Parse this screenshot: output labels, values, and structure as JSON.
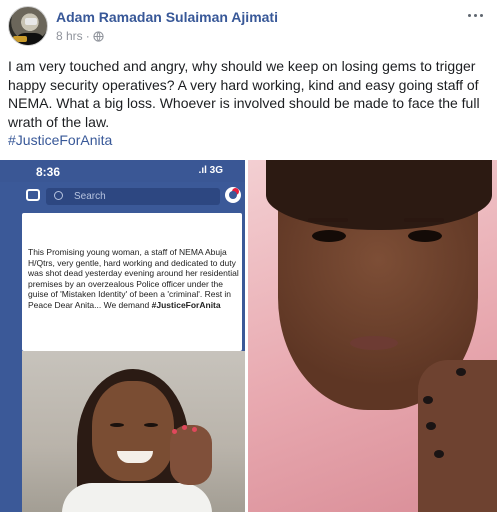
{
  "post": {
    "author": "Adam Ramadan Sulaiman Ajimati",
    "timestamp": "8 hrs",
    "separator": "·",
    "privacy_icon": "globe-icon",
    "more_icon": "ellipsis-icon",
    "body": "I am very touched and angry, why should we keep on losing gems to trigger happy security operatives? A very hard working, kind and easy going staff of NEMA. What a big loss. Whoever is involved should be made to face the full wrath of the law.",
    "hashtag": "#JusticeForAnita"
  },
  "colors": {
    "link": "#385898",
    "meta": "#90949c",
    "facebook_blue": "#3b5998"
  },
  "phone_screenshot": {
    "time": "8:36",
    "signal": ".ıl 3G",
    "search_placeholder": "Search",
    "caption": "This Promising young woman,  a staff of NEMA  Abuja H/Qtrs, very gentle, hard working and dedicated to duty was shot dead yesterday evening around her residential premises by an overzealous Police officer under the guise of 'Mistaken Identity' of been  a 'criminal'. Rest in Peace Dear Anita... We demand",
    "caption_hashtag": "#JusticeForAnita"
  }
}
